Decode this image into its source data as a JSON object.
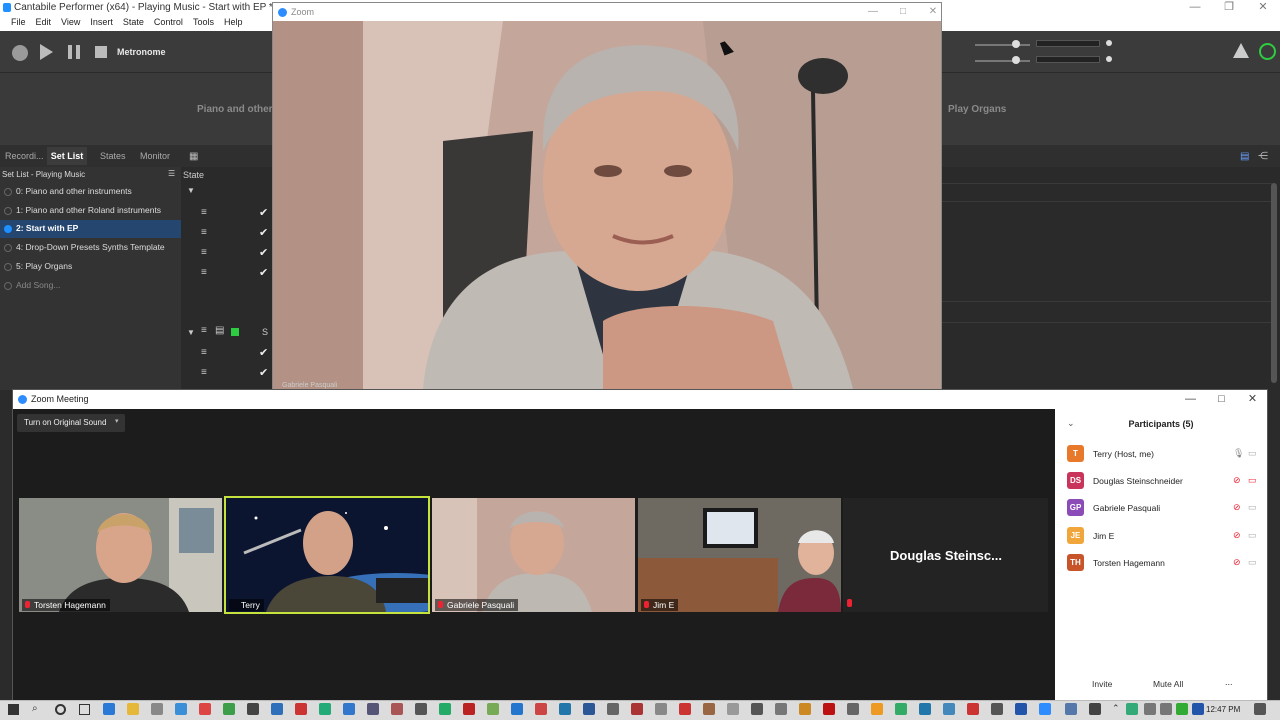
{
  "cantabile": {
    "title": "Cantabile Performer (x64) - Playing Music - Start with EP *",
    "window_controls": [
      "—",
      "❐",
      "✕"
    ],
    "menu": [
      "File",
      "Edit",
      "View",
      "Insert",
      "State",
      "Control",
      "Tools",
      "Help"
    ],
    "toolbar": {
      "metronome": "Metronome"
    },
    "banner": {
      "left": "Piano and other i",
      "right": "Play Organs"
    },
    "tabs": [
      "Recordi...",
      "Set List",
      "States",
      "Monitor"
    ],
    "setlist": {
      "header": "Set List - Playing Music",
      "songs": [
        {
          "label": "0: Piano and other instruments",
          "active": false
        },
        {
          "label": "1: Piano and other Roland instruments",
          "active": false
        },
        {
          "label": "2: Start with EP",
          "active": true
        },
        {
          "label": "4: Drop-Down Presets Synths Template",
          "active": false
        },
        {
          "label": "5: Play Organs",
          "active": false
        }
      ],
      "add_song": "Add Song..."
    },
    "state_header": "State",
    "state_col_s": "S"
  },
  "zoom_video": {
    "title": "Zoom",
    "window_controls": [
      "—",
      "□",
      "✕"
    ],
    "overlay_name": "Gabriele Pasquali"
  },
  "zoom_meeting": {
    "title": "Zoom Meeting",
    "window_controls": [
      "—",
      "□",
      "✕"
    ],
    "original_sound": "Turn on Original Sound",
    "tiles": [
      {
        "name": "Torsten Hagemann",
        "active": false
      },
      {
        "name": "Terry",
        "active": true
      },
      {
        "name": "Gabriele Pasquali",
        "active": false
      },
      {
        "name": "Jim E",
        "active": false
      }
    ],
    "douglas_tile": "Douglas Steinsc...",
    "participants": {
      "title": "Participants (5)",
      "list": [
        {
          "initials": "T",
          "name": "Terry (Host, me)",
          "color": "#e8792b"
        },
        {
          "initials": "DS",
          "name": "Douglas Steinschneider",
          "color": "#c8345a"
        },
        {
          "initials": "GP",
          "name": "Gabriele Pasquali",
          "color": "#8b4cb8"
        },
        {
          "initials": "JE",
          "name": "Jim E",
          "color": "#f0a63a"
        },
        {
          "initials": "TH",
          "name": "Torsten Hagemann",
          "color": "#c8542a"
        }
      ],
      "invite": "Invite",
      "mute_all": "Mute All",
      "more": "..."
    }
  },
  "taskbar": {
    "clock": "12:47 PM"
  },
  "colors": {
    "accent": "#2d8cff",
    "active_tile": "#c6e23c",
    "setlist_active": "#24466f"
  }
}
